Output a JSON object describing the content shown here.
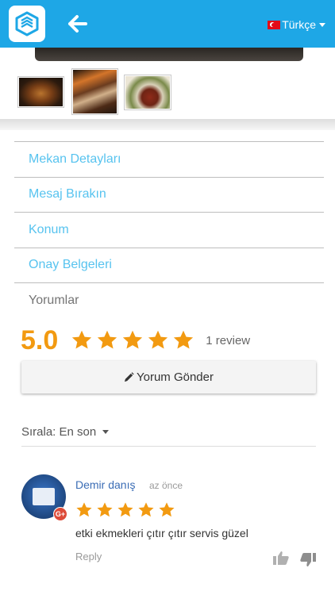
{
  "header": {
    "language_label": "Türkçe",
    "icons": {
      "logo": "sketchup-logo-icon",
      "back": "arrow-left-icon",
      "flag": "turkey-flag-icon"
    },
    "color": "#1ea7e6"
  },
  "nav": {
    "items": [
      {
        "label": "Mekan Detayları"
      },
      {
        "label": "Mesaj Bırakın"
      },
      {
        "label": "Konum"
      },
      {
        "label": "Onay Belgeleri"
      },
      {
        "label": "Yorumlar"
      }
    ],
    "active_color": "#57c3ef"
  },
  "rating": {
    "score": "5.0",
    "stars": 5,
    "review_count": "1 review",
    "star_color": "#f29a11"
  },
  "write_review_button": {
    "label": "Yorum Gönder"
  },
  "sort": {
    "label": "Sırala: En son"
  },
  "comment": {
    "author": "Demir danış",
    "time": "az önce",
    "stars": 5,
    "text": "etki ekmekleri çıtır çıtır servis güzel",
    "reply_label": "Reply",
    "badge": "G+"
  }
}
